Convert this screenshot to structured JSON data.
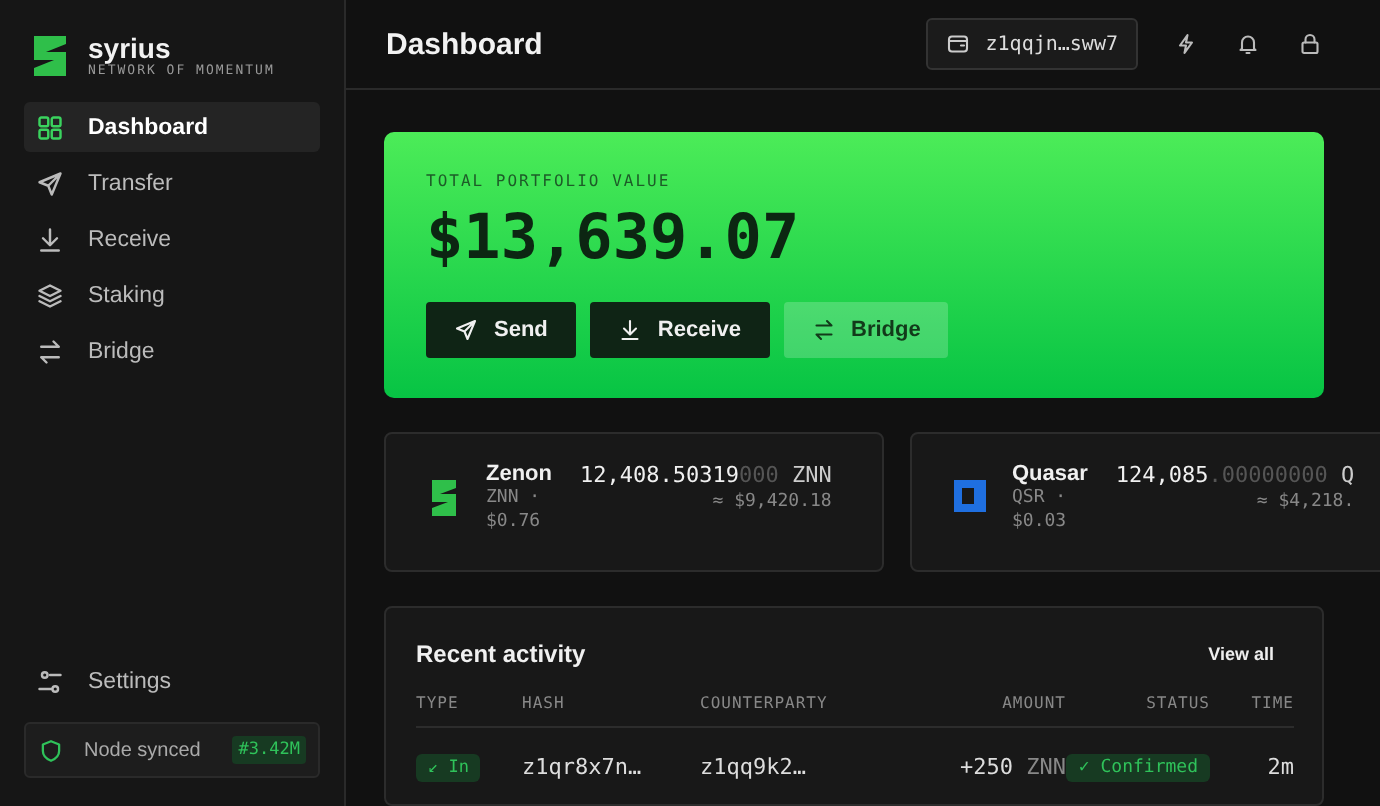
{
  "sidebar": {
    "brand": {
      "name": "syrius",
      "tagline": "NETWORK OF MOMENTUM"
    },
    "items": [
      {
        "label": "Dashboard",
        "selected": true
      },
      {
        "label": "Transfer",
        "selected": false
      },
      {
        "label": "Receive",
        "selected": false
      },
      {
        "label": "Staking",
        "selected": false
      },
      {
        "label": "Bridge",
        "selected": false
      }
    ],
    "settings": {
      "label": "Settings"
    },
    "node": {
      "label": "Node synced",
      "height": "#3.42M"
    }
  },
  "header": {
    "title": "Dashboard",
    "wallet": "z1qqjn…sww7"
  },
  "portfolio": {
    "label": "TOTAL PORTFOLIO VALUE",
    "value": "$13,639.07",
    "buttons": [
      {
        "kind": "solid",
        "label": "Send"
      },
      {
        "kind": "solid",
        "label": "Receive"
      },
      {
        "kind": "ghost",
        "label": "Bridge"
      }
    ]
  },
  "tokens": [
    {
      "name": "Zenon",
      "symbol": "ZNN ·",
      "price": "$0.76",
      "amount": "12,408.50319",
      "decimals": "000",
      "unit": "ZNN",
      "usd": "≈ $9,420.18"
    },
    {
      "name": "Quasar",
      "symbol": "QSR ·",
      "price": "$0.03",
      "amount": "124,085",
      "decimals": ".00000000",
      "unit": "Q",
      "usd": "≈ $4,218."
    }
  ],
  "activity": {
    "title": "Recent activity",
    "link": "View all",
    "columns": [
      "TYPE",
      "HASH",
      "COUNTERPARTY",
      "AMOUNT",
      "STATUS",
      "TIME"
    ],
    "rows": [
      {
        "type_label": "↙ In",
        "hash": "z1qr8x7n…",
        "counterparty": "z1qq9k2…",
        "amount": "+250",
        "unit": "ZNN",
        "status_label": "✓ Confirmed",
        "time": "2m"
      }
    ]
  }
}
